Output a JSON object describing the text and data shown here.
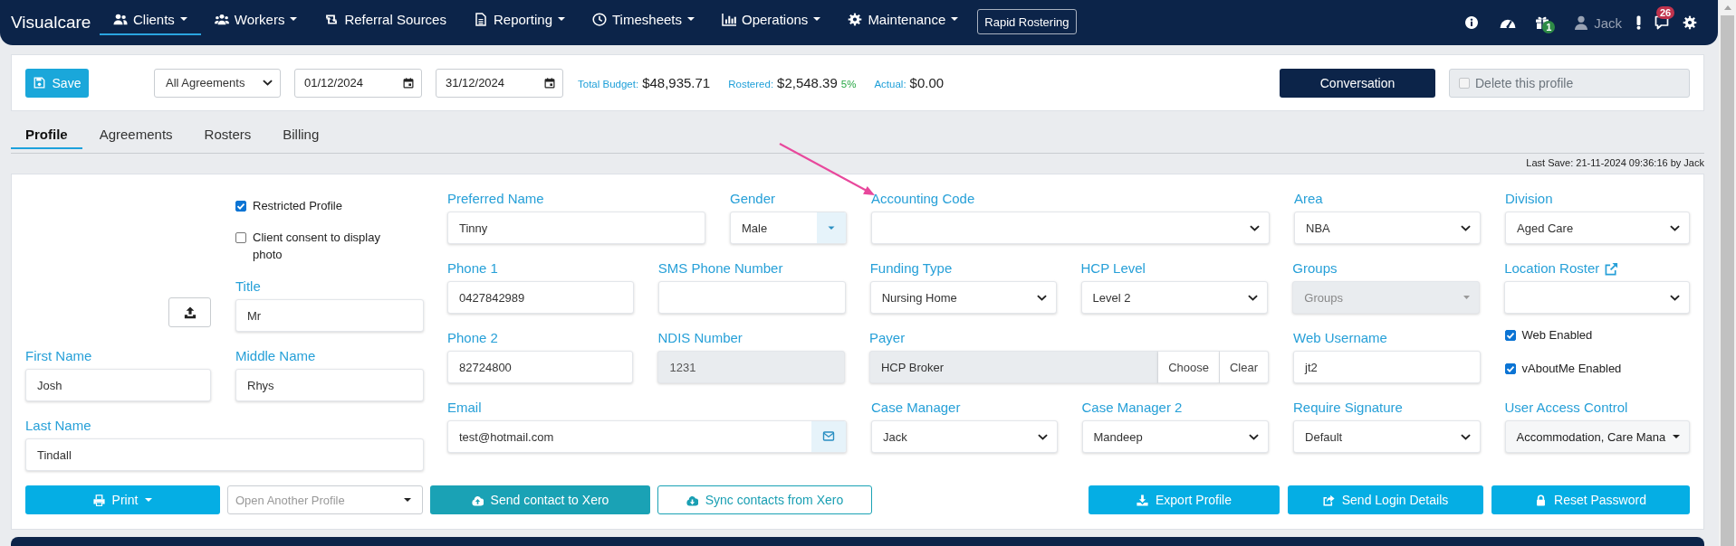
{
  "navbar": {
    "brand": "Visualcare",
    "items": [
      {
        "label": "Clients",
        "dropdown": true,
        "selected": true
      },
      {
        "label": "Workers",
        "dropdown": true,
        "selected": false
      },
      {
        "label": "Referral Sources",
        "dropdown": false,
        "selected": false
      },
      {
        "label": "Reporting",
        "dropdown": true,
        "selected": false
      },
      {
        "label": "Timesheets",
        "dropdown": true,
        "selected": false
      },
      {
        "label": "Operations",
        "dropdown": true,
        "selected": false
      },
      {
        "label": "Maintenance",
        "dropdown": true,
        "selected": false
      }
    ],
    "button": "Rapid Rostering",
    "tools": [
      {
        "kind": "info"
      },
      {
        "kind": "dashboard"
      },
      {
        "kind": "gift",
        "badge": "1",
        "color": "#2e8b46"
      },
      {
        "kind": "user",
        "label": "Jack"
      },
      {
        "kind": "alert"
      },
      {
        "kind": "messages",
        "badge": "26",
        "color": "#c0334d"
      },
      {
        "kind": "settings"
      }
    ]
  },
  "toolbar": {
    "save": "Save",
    "agreements": "All Agreements",
    "start_date": "01/12/2024",
    "end_date": "31/12/2024",
    "totals": [
      {
        "label": "Total Budget:",
        "value": "$48,935.71"
      },
      {
        "label": "Rostered:",
        "value": "$2,548.39",
        "percent": "5%"
      },
      {
        "label": "Actual:",
        "value": "$0.00"
      }
    ],
    "conversation": "Conversation",
    "delete_profile": {
      "label": "Delete this profile",
      "checked": false
    }
  },
  "tabs": [
    {
      "label": "Profile",
      "selected": true
    },
    {
      "label": "Agreements",
      "selected": false
    },
    {
      "label": "Rosters",
      "selected": false
    },
    {
      "label": "Billing",
      "selected": false
    }
  ],
  "last_save": "Last Save: 21-11-2024 09:36:16 by Jack",
  "profile": {
    "options": [
      {
        "label": "Restricted Profile",
        "checked": true
      },
      {
        "label": "Client consent to display photo",
        "checked": false
      }
    ],
    "name_fields": [
      {
        "label": "Title",
        "value": "Mr"
      },
      {
        "label": "First Name",
        "value": "Josh"
      },
      {
        "label": "Middle Name",
        "value": "Rhys"
      },
      {
        "label": "Last Name",
        "value": "Tindall"
      }
    ],
    "fields": [
      {
        "kind": "text",
        "label": "Preferred Name",
        "value": "Tinny"
      },
      {
        "kind": "addon_select",
        "label": "Gender",
        "value": "Male"
      },
      {
        "kind": "select",
        "label": "Accounting Code"
      },
      {
        "kind": "select",
        "label": "Area",
        "value": "NBA"
      },
      {
        "kind": "select",
        "label": "Division",
        "value": "Aged Care"
      },
      {
        "kind": "text",
        "label": "Phone 1",
        "value": "0427842989"
      },
      {
        "kind": "text",
        "label": "SMS Phone Number"
      },
      {
        "kind": "select",
        "label": "Funding Type",
        "value": "Nursing Home"
      },
      {
        "kind": "select",
        "label": "HCP Level",
        "value": "Level 2"
      },
      {
        "kind": "multiselect",
        "label": "Groups",
        "placeholder": "Groups"
      },
      {
        "kind": "select",
        "label": "Location Roster",
        "link": true
      },
      {
        "kind": "text",
        "label": "Phone 2",
        "value": "82724800"
      },
      {
        "kind": "readonly",
        "label": "NDIS Number",
        "value": "1231"
      },
      {
        "kind": "lookup",
        "label": "Payer",
        "value": "HCP Broker",
        "buttons": [
          "Choose",
          "Clear"
        ]
      },
      {
        "kind": "text",
        "label": "Web Username",
        "value": "jt2"
      },
      {
        "kind": "checks",
        "items": [
          {
            "label": "Web Enabled",
            "checked": true
          },
          {
            "label": "vAboutMe Enabled",
            "checked": true
          }
        ]
      },
      {
        "kind": "email",
        "label": "Email",
        "value": "test@hotmail.com"
      },
      {
        "kind": "select",
        "label": "Case Manager",
        "value": "Jack"
      },
      {
        "kind": "select",
        "label": "Case Manager 2",
        "value": "Mandeep"
      },
      {
        "kind": "select",
        "label": "Require Signature",
        "value": "Default"
      },
      {
        "kind": "dropdown",
        "label": "User Access Control",
        "value": "Accommodation, Care Mana"
      }
    ]
  },
  "actions": {
    "left": [
      {
        "kind": "primary",
        "label": "Print",
        "dropdown": true
      },
      {
        "kind": "select",
        "placeholder": "Open Another Profile"
      },
      {
        "kind": "teal",
        "label": "Send contact to Xero",
        "dropdown": false
      },
      {
        "kind": "outline",
        "label": "Sync contacts from Xero",
        "dropdown": false
      }
    ],
    "right": [
      {
        "kind": "primary",
        "label": "Export Profile",
        "dropdown": false
      },
      {
        "kind": "primary",
        "label": "Send Login Details",
        "dropdown": false
      },
      {
        "kind": "primary",
        "label": "Reset Password",
        "dropdown": false
      }
    ]
  },
  "annotations": [
    {
      "kind": "arrow"
    }
  ]
}
